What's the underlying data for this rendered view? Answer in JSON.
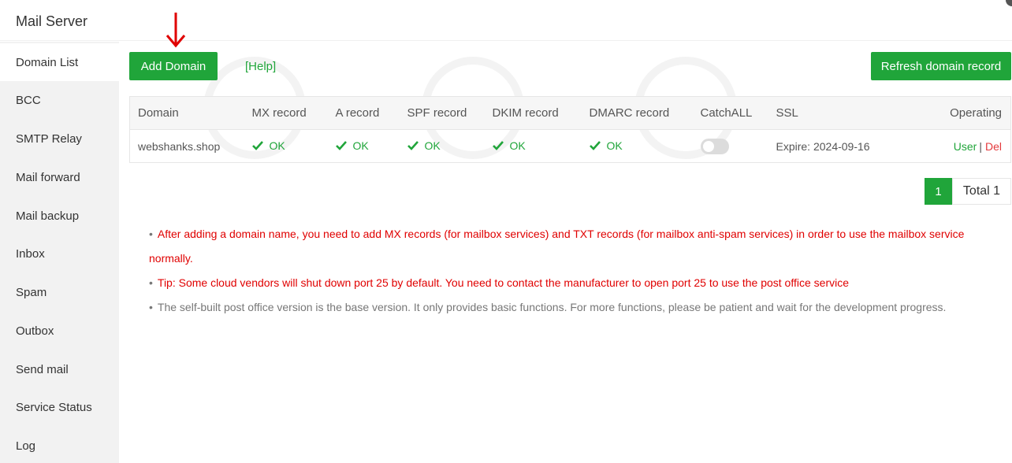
{
  "app": {
    "title": "Mail Server"
  },
  "sidebar": {
    "items": [
      {
        "label": "Domain List",
        "active": true
      },
      {
        "label": "BCC"
      },
      {
        "label": "SMTP Relay"
      },
      {
        "label": "Mail forward"
      },
      {
        "label": "Mail backup"
      },
      {
        "label": "Inbox"
      },
      {
        "label": "Spam"
      },
      {
        "label": "Outbox"
      },
      {
        "label": "Send mail"
      },
      {
        "label": "Service Status"
      },
      {
        "label": "Log"
      }
    ]
  },
  "toolbar": {
    "add_domain": "Add Domain",
    "help": "[Help]",
    "refresh": "Refresh domain record"
  },
  "table": {
    "headers": [
      "Domain",
      "MX record",
      "A record",
      "SPF record",
      "DKIM record",
      "DMARC record",
      "CatchALL",
      "SSL",
      "Operating"
    ],
    "rows": [
      {
        "domain": "webshanks.shop",
        "mx": "OK",
        "a": "OK",
        "spf": "OK",
        "dkim": "OK",
        "dmarc": "OK",
        "catchall": false,
        "ssl": "Expire: 2024-09-16",
        "op_user": "User",
        "op_sep": "|",
        "op_del": "Del"
      }
    ]
  },
  "pagination": {
    "current": "1",
    "total": "Total 1"
  },
  "notes": [
    {
      "color": "red",
      "text": "After adding a domain name, you need to add MX records (for mailbox services) and TXT records (for mailbox anti-spam services) in order to use the mailbox service normally."
    },
    {
      "color": "red",
      "text": "Tip: Some cloud vendors will shut down port 25 by default. You need to contact the manufacturer to open port 25 to use the post office service"
    },
    {
      "color": "grey",
      "text": "The self-built post office version is the base version. It only provides basic functions. For more functions, please be patient and wait for the development progress."
    }
  ],
  "colors": {
    "accent": "#20a53a",
    "danger": "#e4393c",
    "note_red": "#e00000",
    "arrow": "#e00000"
  }
}
